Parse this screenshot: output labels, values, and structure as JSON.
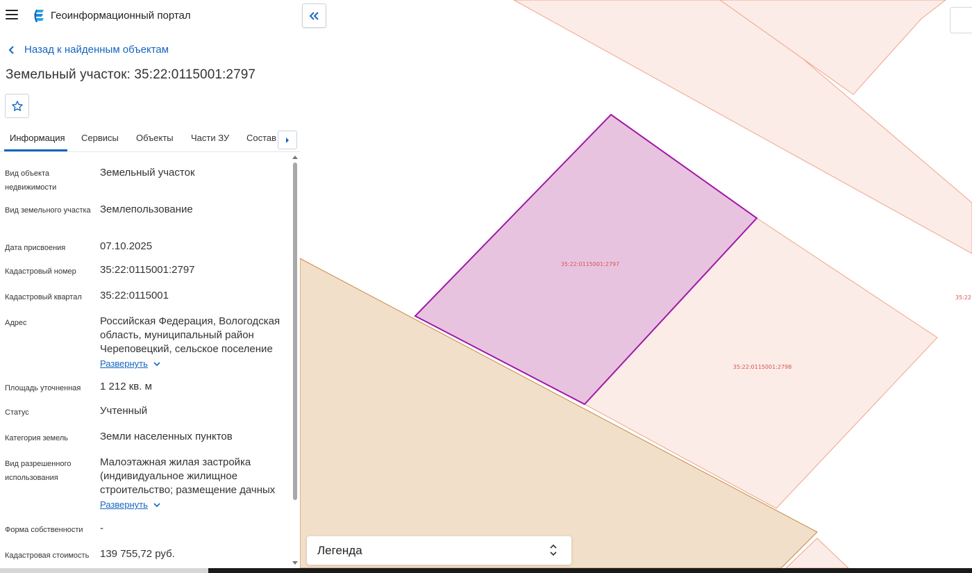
{
  "app": {
    "title": "Геоинформационный портал"
  },
  "nav": {
    "back_label": "Назад к найденным объектам"
  },
  "object": {
    "title": "Земельный участок: 35:22:0115001:2797"
  },
  "tabs": [
    {
      "label": "Информация",
      "active": true
    },
    {
      "label": "Сервисы",
      "active": false
    },
    {
      "label": "Объекты",
      "active": false
    },
    {
      "label": "Части ЗУ",
      "active": false
    },
    {
      "label": "Состав",
      "active": false
    }
  ],
  "info": {
    "rows": [
      {
        "label": "Вид объекта недвижимости",
        "value": "Земельный участок"
      },
      {
        "label": "Вид земельного участка",
        "value": "Землепользование"
      },
      {
        "label": "Дата присвоения",
        "value": "07.10.2025"
      },
      {
        "label": "Кадастровый номер",
        "value": "35:22:0115001:2797"
      },
      {
        "label": "Кадастровый квартал",
        "value": "35:22:0115001"
      },
      {
        "label": "Адрес",
        "value": "Российская Федерация, Вологодская область, муниципальный район Череповецкий, сельское поселение",
        "expand": "Развернуть"
      },
      {
        "label": "Площадь уточненная",
        "value": "1 212 кв. м"
      },
      {
        "label": "Статус",
        "value": "Учтенный"
      },
      {
        "label": "Категория земель",
        "value": "Земли населенных пунктов"
      },
      {
        "label": "Вид разрешенного использования",
        "value": "Малоэтажная жилая застройка (индивидуальное жилищное строительство; размещение дачных",
        "expand": "Развернуть"
      },
      {
        "label": "Форма собственности",
        "value": "-"
      },
      {
        "label": "Кадастровая стоимость",
        "value": "139 755,72 руб."
      }
    ]
  },
  "map": {
    "parcel_selected_label": "35:22:0115001:2797",
    "parcel_neighbor_label": "35:22:0115001:2798",
    "parcel_edge_label": "35:22",
    "colors": {
      "selected_fill": "#e8c3df",
      "selected_stroke": "#a018a8",
      "parcel_fill": "#fbece7",
      "parcel_stroke": "#f0a48a",
      "land_fill": "#f1dfca",
      "land_stroke": "#c7893f",
      "label_color": "#d9534f"
    }
  },
  "legend": {
    "label": "Легенда"
  },
  "icons": {
    "menu": "menu-icon",
    "logo": "portal-logo-icon",
    "back": "chevron-left-icon",
    "favorite": "star-icon",
    "tab_next": "caret-right-icon",
    "collapse": "double-chevron-left-icon",
    "expand": "chevron-down-icon",
    "legend": "up-down-arrows-icon"
  }
}
